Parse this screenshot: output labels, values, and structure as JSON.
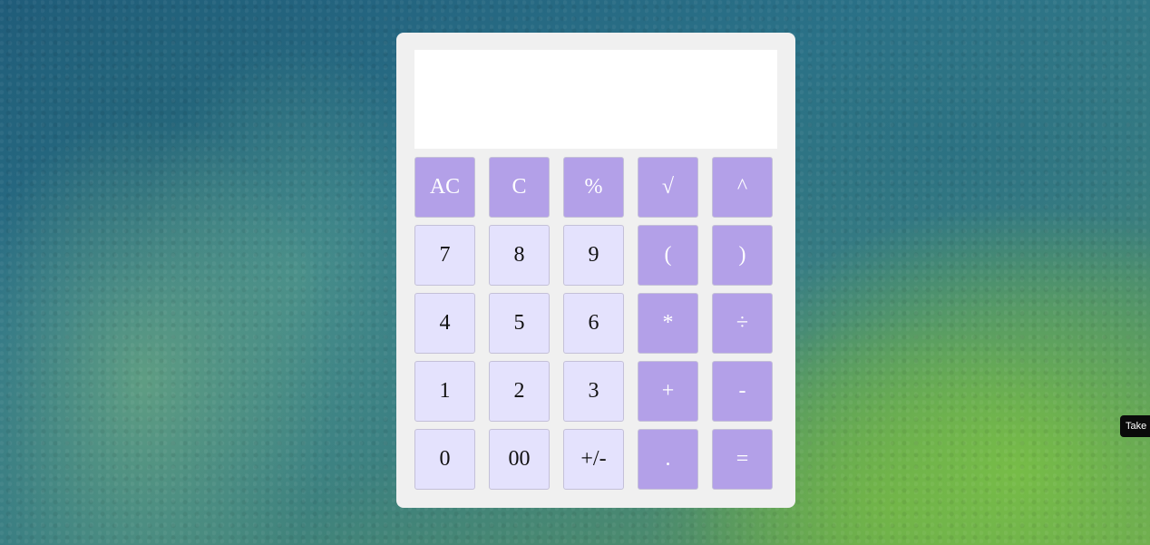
{
  "display": {
    "value": ""
  },
  "keys": [
    [
      "AC",
      "C",
      "%",
      "√",
      "^"
    ],
    [
      "7",
      "8",
      "9",
      "(",
      ")"
    ],
    [
      "4",
      "5",
      "6",
      "*",
      "÷"
    ],
    [
      "1",
      "2",
      "3",
      "+",
      "-"
    ],
    [
      "0",
      "00",
      "+/-",
      ".",
      "="
    ]
  ],
  "tooltip": {
    "text": "Take"
  },
  "colors": {
    "operator_key": "#b3a0e8",
    "number_key": "#e4e2fd",
    "panel": "#f0f0f0",
    "display": "#ffffff"
  }
}
